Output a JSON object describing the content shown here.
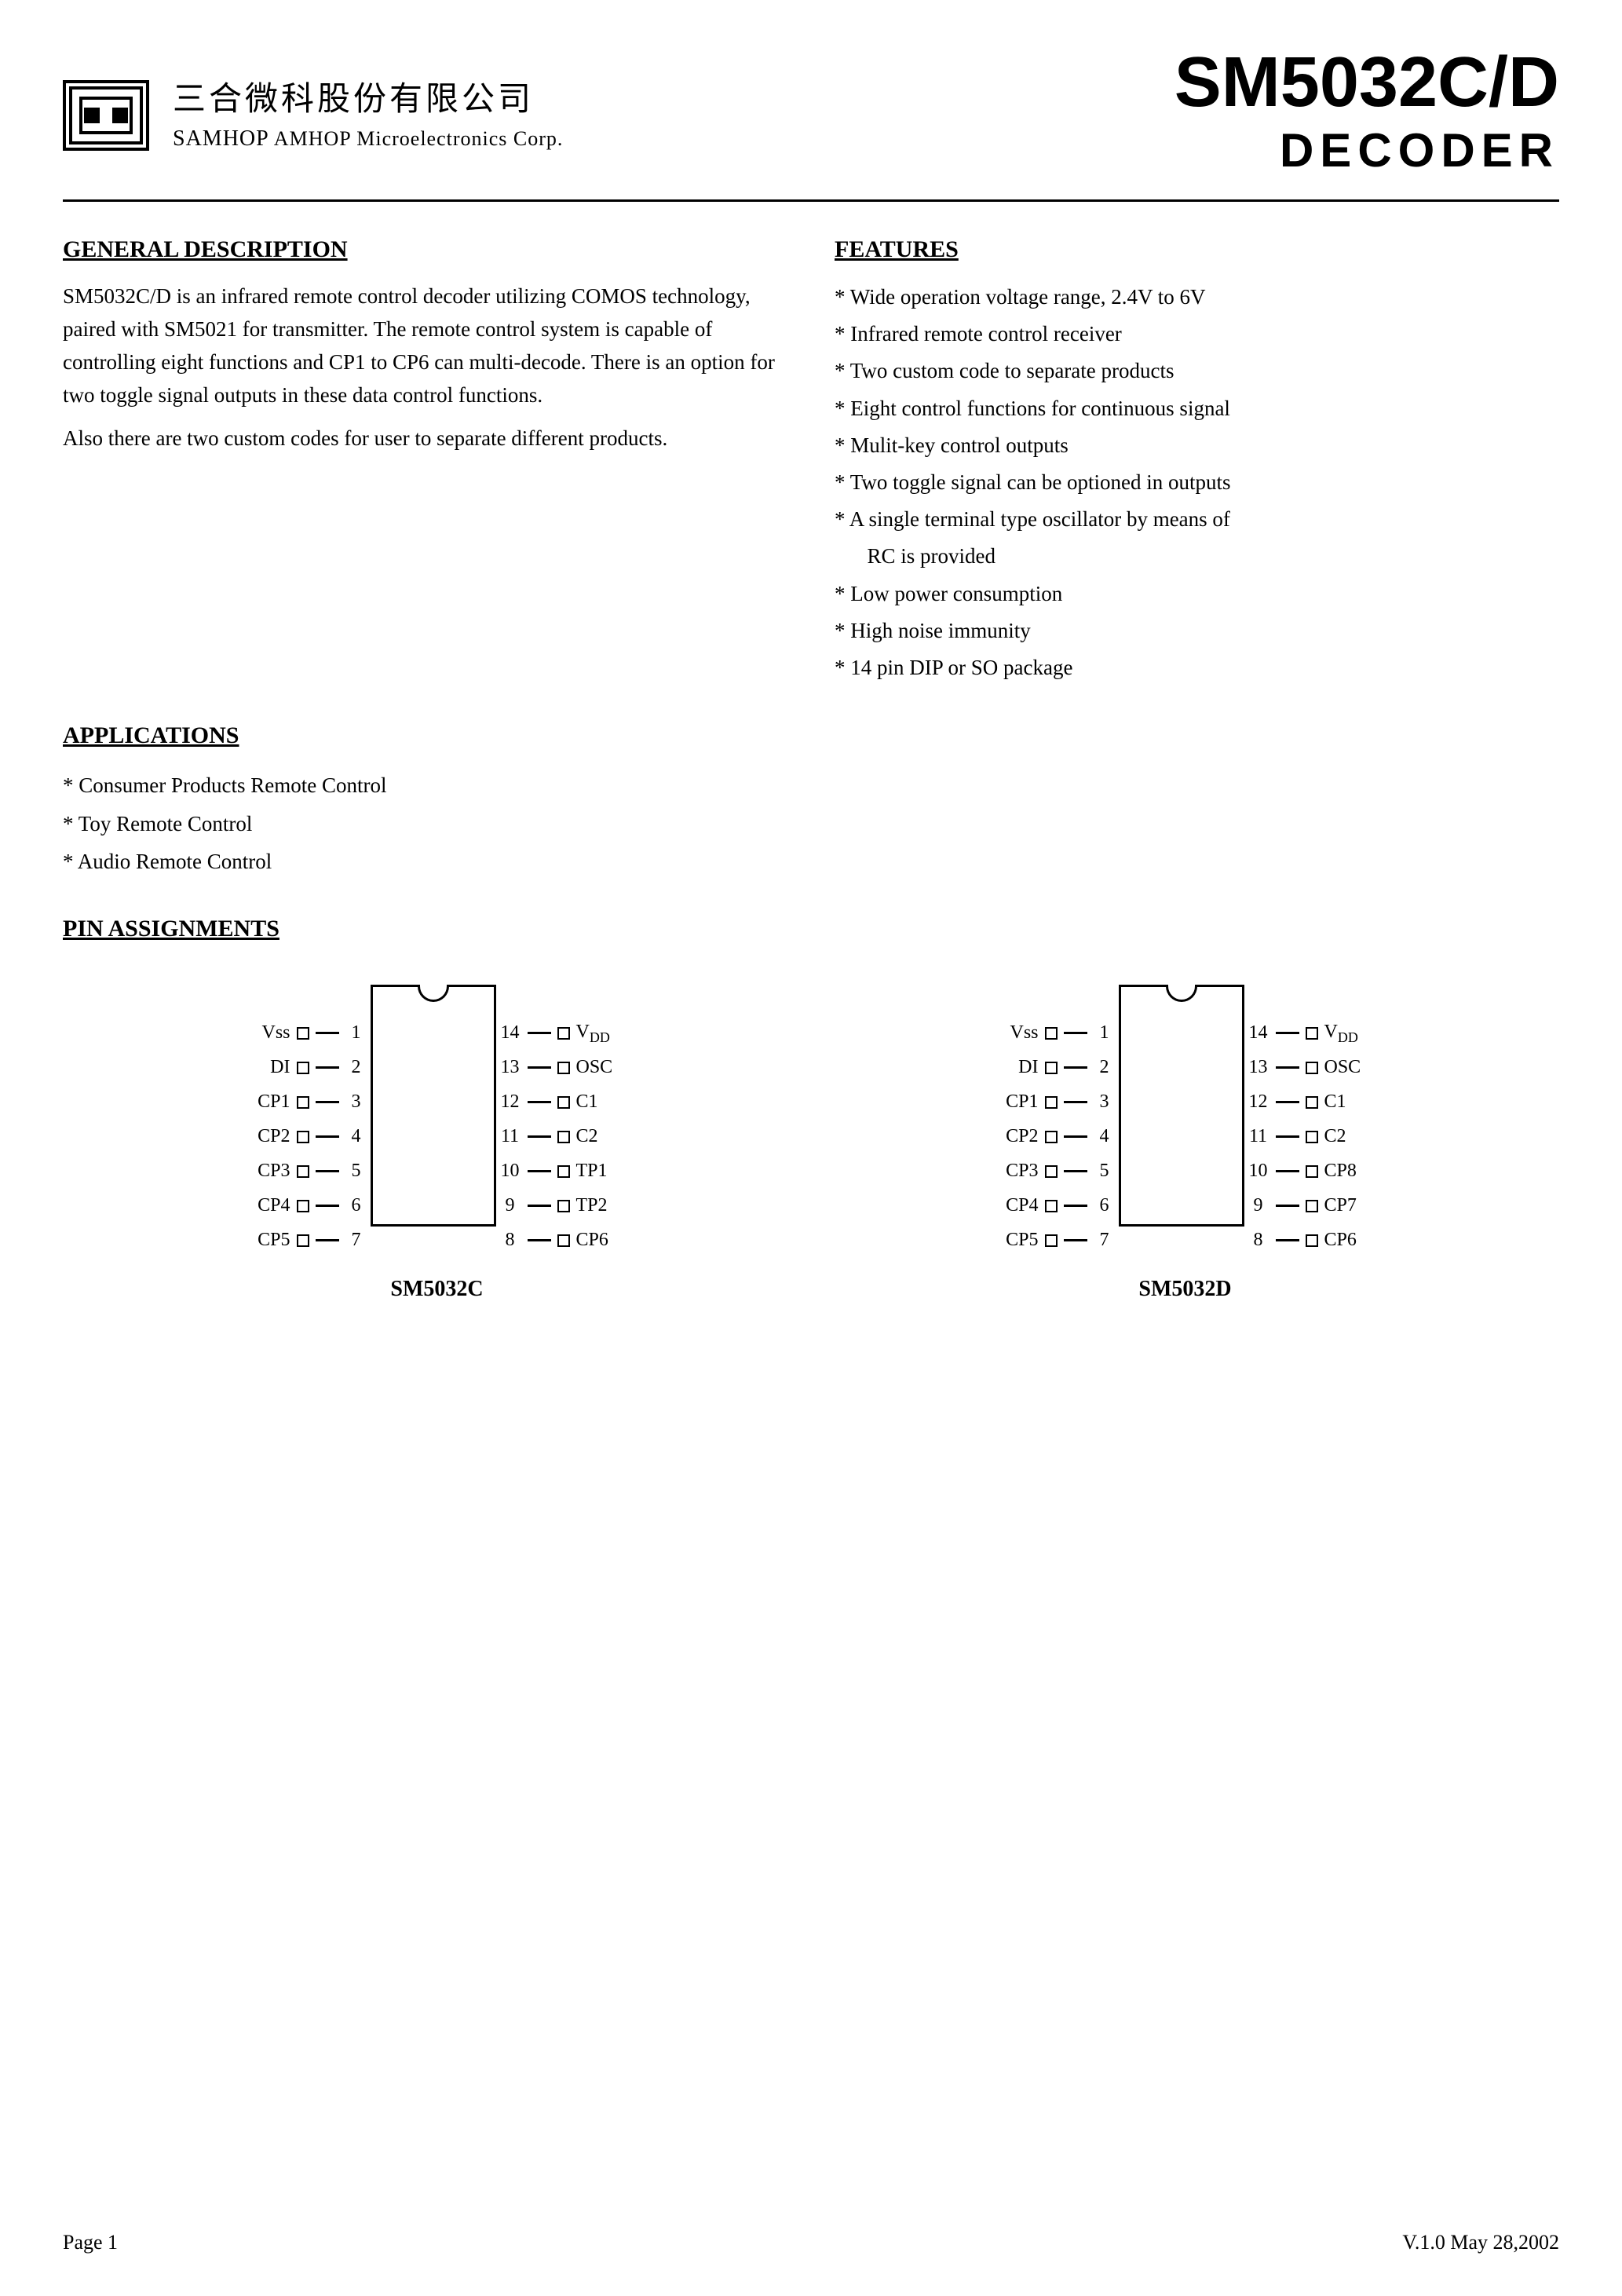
{
  "header": {
    "chinese_name": "三合微科股份有限公司",
    "english_name_prefix": "S",
    "english_name": "AMHOP Microelectronics Corp.",
    "chip_title": "SM5032C/D",
    "chip_subtitle": "DECODER"
  },
  "general_description": {
    "title": "GENERAL DESCRIPTION",
    "body1": "SM5032C/D is an infrared remote control decoder utilizing COMOS technology, paired with SM5021 for transmitter.  The remote control system is capable of controlling eight functions and CP1 to CP6  can multi-decode.  There is an option for two toggle signal outputs in these data control functions.",
    "body2": "Also there are two custom codes for user to separate different products."
  },
  "features": {
    "title": "FEATURES",
    "items": [
      "Wide operation voltage range, 2.4V to 6V",
      "Infrared remote control receiver",
      "Two custom code to separate products",
      "Eight control functions for continuous signal",
      "Mulit-key control outputs",
      "Two toggle signal can be optioned in outputs",
      "A single terminal type oscillator by means of",
      "RC is provided",
      "Low power consumption",
      "High noise immunity",
      "14 pin DIP or SO package"
    ]
  },
  "applications": {
    "title": "APPLICATIONS",
    "items": [
      "Consumer Products Remote Control",
      "Toy Remote Control",
      "Audio Remote Control"
    ]
  },
  "pin_assignments": {
    "title": "PIN ASSIGNMENTS",
    "sm5032c": {
      "label": "SM5032C",
      "left_pins": [
        {
          "name": "Vss",
          "num": "1"
        },
        {
          "name": "DI",
          "num": "2"
        },
        {
          "name": "CP1",
          "num": "3"
        },
        {
          "name": "CP2",
          "num": "4"
        },
        {
          "name": "CP3",
          "num": "5"
        },
        {
          "name": "CP4",
          "num": "6"
        },
        {
          "name": "CP5",
          "num": "7"
        }
      ],
      "right_pins": [
        {
          "num": "14",
          "name": "VDD"
        },
        {
          "num": "13",
          "name": "OSC"
        },
        {
          "num": "12",
          "name": "C1"
        },
        {
          "num": "11",
          "name": "C2"
        },
        {
          "num": "10",
          "name": "TP1"
        },
        {
          "num": "9",
          "name": "TP2"
        },
        {
          "num": "8",
          "name": "CP6"
        }
      ]
    },
    "sm5032d": {
      "label": "SM5032D",
      "left_pins": [
        {
          "name": "Vss",
          "num": "1"
        },
        {
          "name": "DI",
          "num": "2"
        },
        {
          "name": "CP1",
          "num": "3"
        },
        {
          "name": "CP2",
          "num": "4"
        },
        {
          "name": "CP3",
          "num": "5"
        },
        {
          "name": "CP4",
          "num": "6"
        },
        {
          "name": "CP5",
          "num": "7"
        }
      ],
      "right_pins": [
        {
          "num": "14",
          "name": "VDD"
        },
        {
          "num": "13",
          "name": "OSC"
        },
        {
          "num": "12",
          "name": "C1"
        },
        {
          "num": "11",
          "name": "C2"
        },
        {
          "num": "10",
          "name": "CP8"
        },
        {
          "num": "9",
          "name": "CP7"
        },
        {
          "num": "8",
          "name": "CP6"
        }
      ]
    }
  },
  "footer": {
    "page": "Page 1",
    "version": "V.1.0 May 28,2002"
  }
}
